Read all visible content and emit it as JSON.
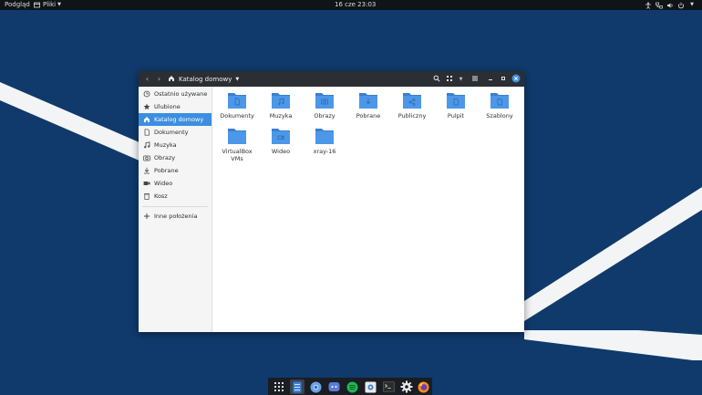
{
  "panel": {
    "preview_label": "Podgląd",
    "files_menu_label": "Pliki",
    "clock": "16 cze  23:03"
  },
  "window": {
    "path_label": "Katalog domowy"
  },
  "sidebar": {
    "items": [
      {
        "label": "Ostatnio używane",
        "icon": "clock-icon"
      },
      {
        "label": "Ulubione",
        "icon": "star-icon"
      },
      {
        "label": "Katalog domowy",
        "icon": "home-icon"
      },
      {
        "label": "Dokumenty",
        "icon": "document-icon"
      },
      {
        "label": "Muzyka",
        "icon": "music-icon"
      },
      {
        "label": "Obrazy",
        "icon": "camera-icon"
      },
      {
        "label": "Pobrane",
        "icon": "download-icon"
      },
      {
        "label": "Wideo",
        "icon": "video-icon"
      },
      {
        "label": "Kosz",
        "icon": "trash-icon"
      }
    ],
    "other_locations": "Inne położenia"
  },
  "files": [
    {
      "label": "Dokumenty",
      "icon": "document"
    },
    {
      "label": "Muzyka",
      "icon": "music"
    },
    {
      "label": "Obrazy",
      "icon": "camera"
    },
    {
      "label": "Pobrane",
      "icon": "download"
    },
    {
      "label": "Publiczny",
      "icon": "share"
    },
    {
      "label": "Pulpit",
      "icon": "desktop"
    },
    {
      "label": "Szablony",
      "icon": "template"
    },
    {
      "label": "VirtualBox VMs",
      "icon": "folder"
    },
    {
      "label": "Wideo",
      "icon": "video"
    },
    {
      "label": "xray-16",
      "icon": "folder"
    }
  ],
  "colors": {
    "accent": "#3c8fe0",
    "folder": "#4a90e2",
    "desktop": "#0f3a6b"
  }
}
